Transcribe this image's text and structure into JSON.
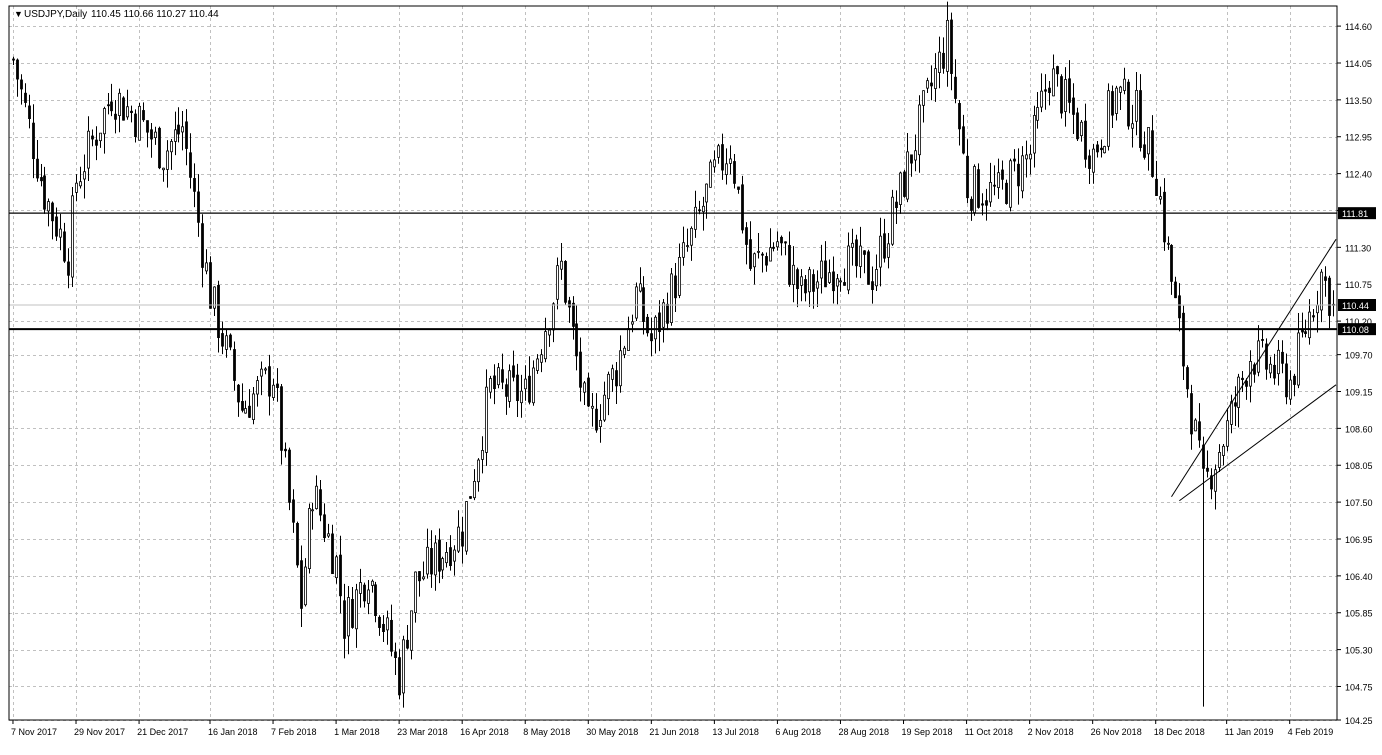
{
  "header": {
    "symbol_label": "USDJPY,Daily",
    "ohlc_label": "110.45 110.66 110.27 110.44",
    "collapse_glyph": "▼"
  },
  "colors": {
    "background": "#ffffff",
    "foreground": "#000000",
    "grid": "#c0c0c0",
    "candle_bull_body": "#ffffff",
    "candle_bear_body": "#000000",
    "price_tag_bg": "#000000",
    "price_tag_text": "#ffffff",
    "current_price_line": "#c0c0c0"
  },
  "chart_data": {
    "type": "candlestick",
    "title": "USDJPY,Daily",
    "ylim": [
      104.25,
      114.9
    ],
    "y_ticks": [
      "114.60",
      "114.05",
      "113.50",
      "112.95",
      "112.40",
      "111.85",
      "111.30",
      "110.75",
      "110.20",
      "109.70",
      "109.15",
      "108.60",
      "108.05",
      "107.50",
      "106.95",
      "106.40",
      "105.85",
      "105.30",
      "104.75",
      "104.25"
    ],
    "x_tick_labels": [
      "7 Nov 2017",
      "29 Nov 2017",
      "21 Dec 2017",
      "16 Jan 2018",
      "7 Feb 2018",
      "1 Mar 2018",
      "23 Mar 2018",
      "16 Apr 2018",
      "8 May 2018",
      "30 May 2018",
      "21 Jun 2018",
      "13 Jul 2018",
      "6 Aug 2018",
      "28 Aug 2018",
      "19 Sep 2018",
      "11 Oct 2018",
      "2 Nov 2018",
      "26 Nov 2018",
      "18 Dec 2018",
      "11 Jan 2019",
      "4 Feb 2019"
    ],
    "horizontal_lines": [
      {
        "price": 111.81,
        "label": "111.81",
        "style": "thin"
      },
      {
        "price": 110.08,
        "label": "110.08",
        "style": "thick"
      }
    ],
    "current_price": {
      "price": 110.44,
      "label": "110.44"
    },
    "channel_lines": [
      {
        "from": {
          "date": "24 Dec 2018",
          "price": 107.58
        },
        "to": {
          "date": "19 Feb 2019",
          "price": 111.42
        }
      },
      {
        "from": {
          "date": "26 Dec 2018",
          "price": 107.52
        },
        "to": {
          "date": "19 Feb 2019",
          "price": 109.25
        }
      }
    ],
    "grid": true,
    "waypoints": [
      {
        "date": "7 Nov 2017",
        "close": 114.1
      },
      {
        "date": "17 Nov 2017",
        "close": 112.1
      },
      {
        "date": "27 Nov 2017",
        "close": 111.2
      },
      {
        "date": "29 Nov 2017",
        "close": 112.3
      },
      {
        "date": "12 Dec 2017",
        "close": 113.6
      },
      {
        "date": "21 Dec 2017",
        "close": 113.2
      },
      {
        "date": "29 Dec 2017",
        "close": 112.7
      },
      {
        "date": "5 Jan 2018",
        "close": 113.1
      },
      {
        "date": "16 Jan 2018",
        "close": 110.6
      },
      {
        "date": "26 Jan 2018",
        "close": 108.9
      },
      {
        "date": "7 Feb 2018",
        "close": 109.4
      },
      {
        "date": "16 Feb 2018",
        "close": 106.0
      },
      {
        "date": "21 Feb 2018",
        "close": 107.7
      },
      {
        "date": "1 Mar 2018",
        "close": 106.6
      },
      {
        "date": "5 Mar 2018",
        "close": 105.7
      },
      {
        "date": "13 Mar 2018",
        "close": 106.5
      },
      {
        "date": "23 Mar 2018",
        "close": 104.9
      },
      {
        "date": "29 Mar 2018",
        "close": 106.3
      },
      {
        "date": "16 Apr 2018",
        "close": 107.1
      },
      {
        "date": "25 Apr 2018",
        "close": 109.2
      },
      {
        "date": "8 May 2018",
        "close": 109.1
      },
      {
        "date": "21 May 2018",
        "close": 111.0
      },
      {
        "date": "30 May 2018",
        "close": 108.6
      },
      {
        "date": "8 Jun 2018",
        "close": 109.5
      },
      {
        "date": "15 Jun 2018",
        "close": 110.6
      },
      {
        "date": "21 Jun 2018",
        "close": 109.9
      },
      {
        "date": "29 Jun 2018",
        "close": 110.8
      },
      {
        "date": "13 Jul 2018",
        "close": 112.4
      },
      {
        "date": "19 Jul 2018",
        "close": 112.8
      },
      {
        "date": "26 Jul 2018",
        "close": 111.0
      },
      {
        "date": "6 Aug 2018",
        "close": 111.4
      },
      {
        "date": "14 Aug 2018",
        "close": 110.6
      },
      {
        "date": "28 Aug 2018",
        "close": 111.1
      },
      {
        "date": "7 Sep 2018",
        "close": 110.9
      },
      {
        "date": "19 Sep 2018",
        "close": 112.3
      },
      {
        "date": "28 Sep 2018",
        "close": 113.7
      },
      {
        "date": "4 Oct 2018",
        "close": 114.4
      },
      {
        "date": "11 Oct 2018",
        "close": 112.2
      },
      {
        "date": "23 Oct 2018",
        "close": 112.1
      },
      {
        "date": "2 Nov 2018",
        "close": 112.7
      },
      {
        "date": "9 Nov 2018",
        "close": 113.9
      },
      {
        "date": "26 Nov 2018",
        "close": 112.7
      },
      {
        "date": "4 Dec 2018",
        "close": 113.6
      },
      {
        "date": "11 Dec 2018",
        "close": 113.3
      },
      {
        "date": "18 Dec 2018",
        "close": 112.4
      },
      {
        "date": "25 Dec 2018",
        "close": 110.4
      },
      {
        "date": "3 Jan 2019",
        "close": 107.7
      },
      {
        "date": "11 Jan 2019",
        "close": 108.6
      },
      {
        "date": "21 Jan 2019",
        "close": 109.7
      },
      {
        "date": "4 Feb 2019",
        "close": 109.3
      },
      {
        "date": "14 Feb 2019",
        "close": 110.9
      },
      {
        "date": "19 Feb 2019",
        "close": 110.44
      }
    ]
  }
}
